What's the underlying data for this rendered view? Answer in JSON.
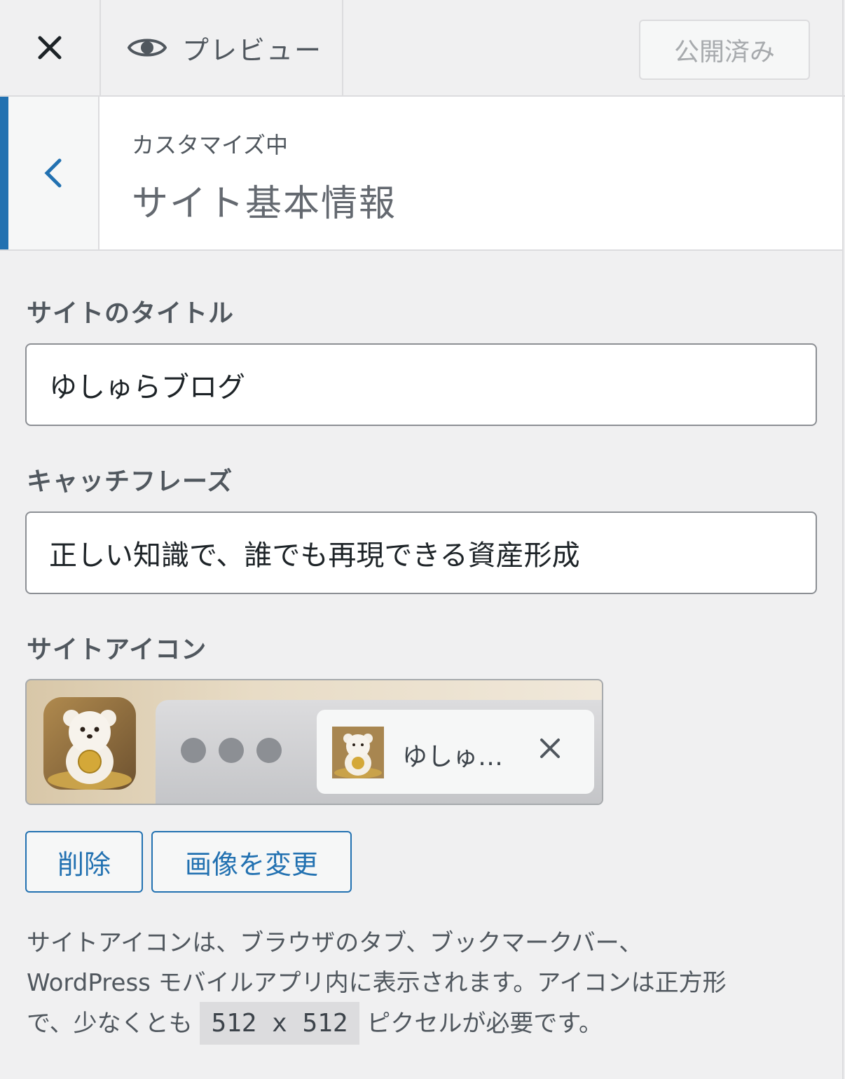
{
  "header": {
    "preview_label": "プレビュー",
    "publish_label": "公開済み"
  },
  "section": {
    "customizing_label": "カスタマイズ中",
    "title": "サイト基本情報"
  },
  "fields": {
    "site_title": {
      "label": "サイトのタイトル",
      "value": "ゆしゅらブログ"
    },
    "tagline": {
      "label": "キャッチフレーズ",
      "value": "正しい知識で、誰でも再現できる資産形成"
    },
    "site_icon": {
      "label": "サイトアイコン",
      "tab_title": "ゆしゅ…",
      "remove_label": "削除",
      "change_label": "画像を変更"
    }
  },
  "description": {
    "line1": "サイトアイコンは、ブラウザのタブ、ブックマークバー、",
    "line2": "WordPress モバイルアプリ内に表示されます。アイコンは正方形",
    "line3_prefix": "で、少なくとも ",
    "size_code": "512 x 512",
    "line3_suffix": " ピクセルが必要です。"
  },
  "colors": {
    "accent": "#2271b1",
    "background": "#f0f0f1"
  }
}
